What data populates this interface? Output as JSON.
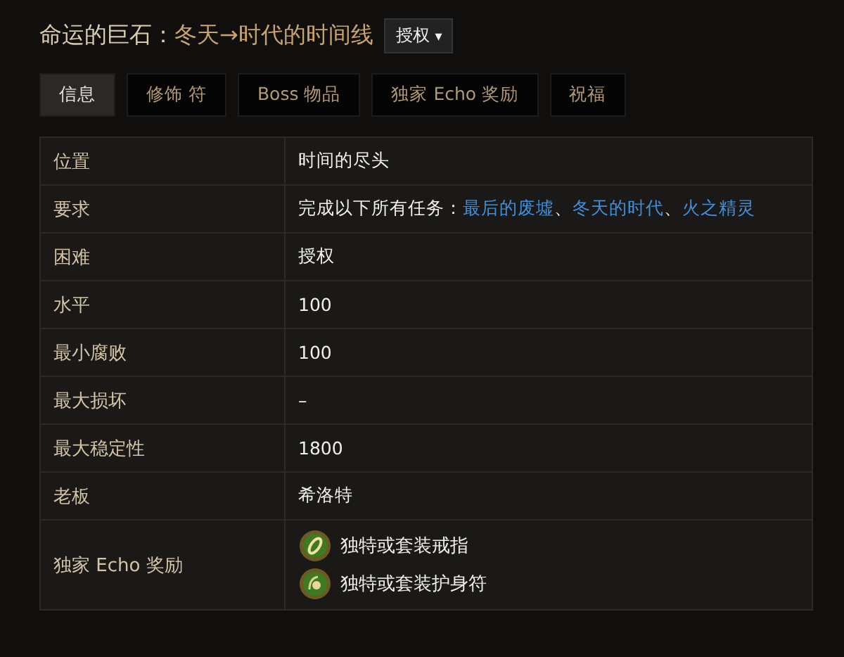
{
  "title": {
    "prefix": "命运的巨石：",
    "main": "冬天→时代的时间线",
    "dropdown": "授权",
    "caret": "▾"
  },
  "tabs": [
    {
      "label": "信息",
      "selected": true
    },
    {
      "label": "修饰 符",
      "selected": false
    },
    {
      "label": "Boss 物品",
      "selected": false
    },
    {
      "label": "独家 Echo 奖励",
      "selected": false
    },
    {
      "label": "祝福",
      "selected": false
    }
  ],
  "rows": [
    {
      "kind": "text",
      "label": "位置",
      "value": "时间的尽头"
    },
    {
      "kind": "links",
      "label": "要求",
      "parts": [
        {
          "kind": "text",
          "text": "完成以下所有任务："
        },
        {
          "kind": "link",
          "text": "最后的废墟"
        },
        {
          "kind": "text",
          "text": "、"
        },
        {
          "kind": "link",
          "text": "冬天的时代"
        },
        {
          "kind": "text",
          "text": "、"
        },
        {
          "kind": "link",
          "text": "火之精灵"
        }
      ]
    },
    {
      "kind": "text",
      "label": "困难",
      "value": "授权"
    },
    {
      "kind": "text",
      "label": "水平",
      "value": "100"
    },
    {
      "kind": "text",
      "label": "最小腐败",
      "value": "100"
    },
    {
      "kind": "text",
      "label": "最大损坏",
      "value": "–"
    },
    {
      "kind": "text",
      "label": "最大稳定性",
      "value": "1800"
    },
    {
      "kind": "text",
      "label": "老板",
      "value": "希洛特"
    },
    {
      "kind": "rewards",
      "label": "独家 Echo 奖励",
      "items": [
        {
          "kind": "ring",
          "text": "独特或套装戒指"
        },
        {
          "kind": "amulet",
          "text": "独特或套装护身符"
        }
      ]
    }
  ]
}
